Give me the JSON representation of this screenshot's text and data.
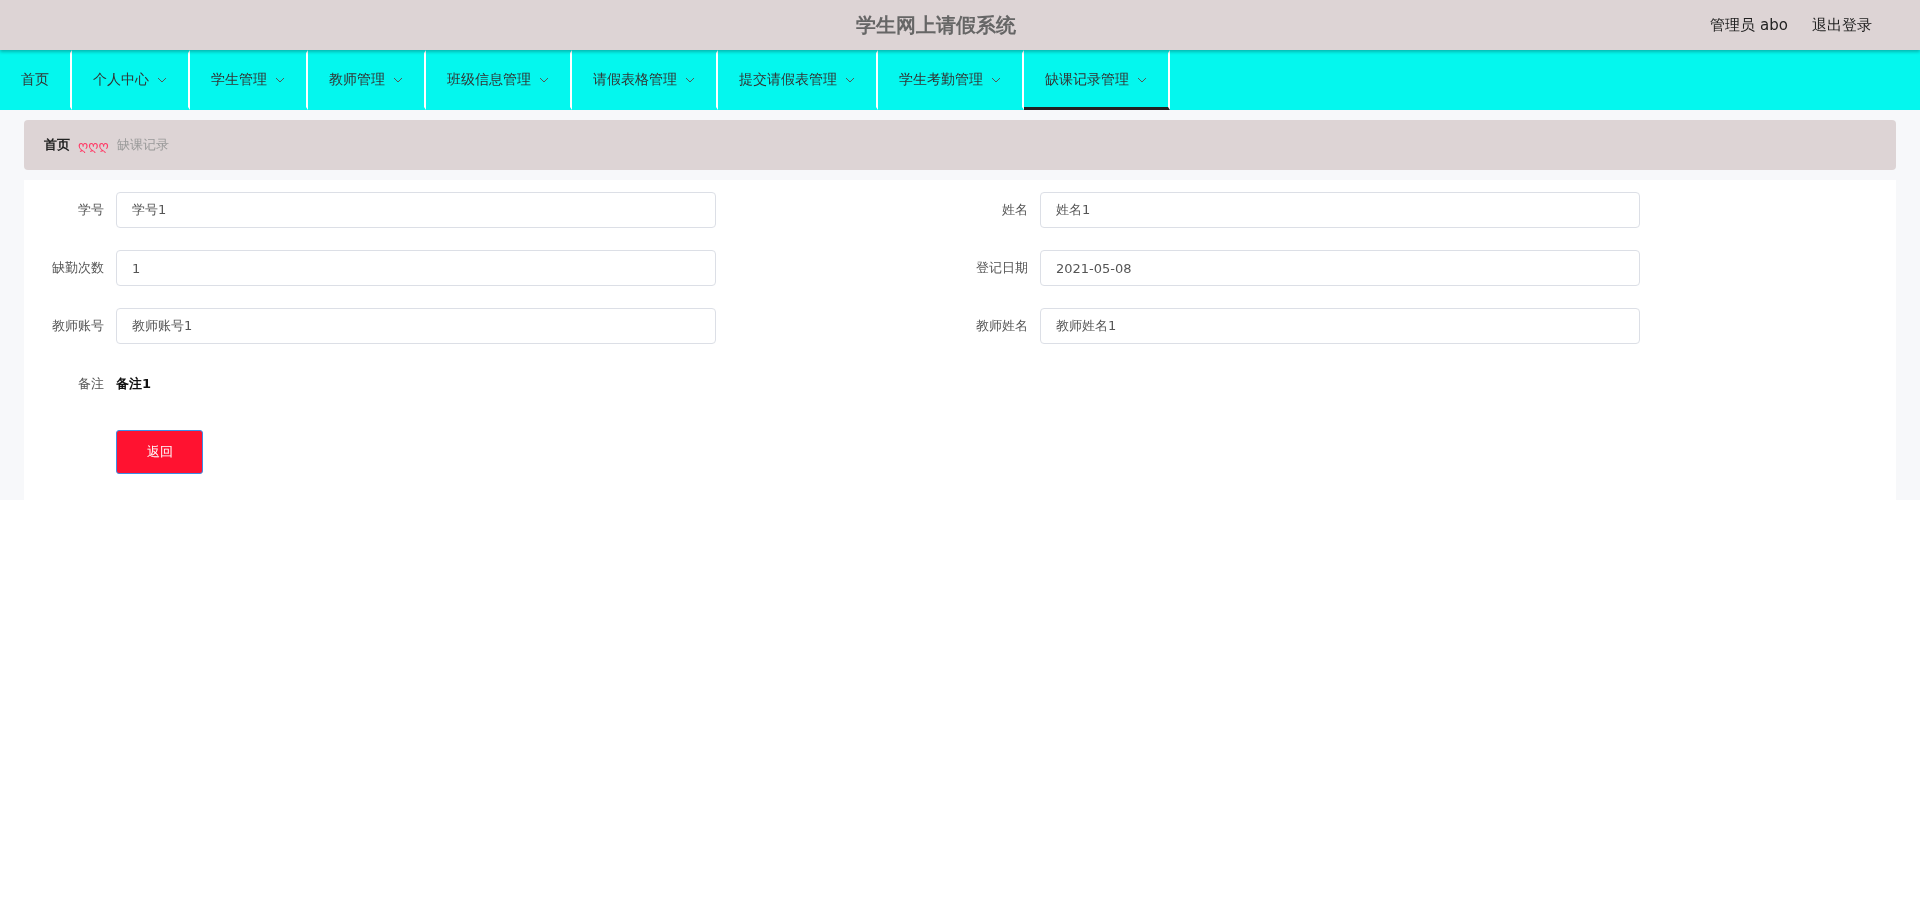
{
  "header": {
    "title": "学生网上请假系统",
    "user": "管理员 abo",
    "logout": "退出登录"
  },
  "nav": [
    {
      "label": "首页",
      "has_menu": false,
      "selected": false
    },
    {
      "label": "个人中心",
      "has_menu": true,
      "selected": false
    },
    {
      "label": "学生管理",
      "has_menu": true,
      "selected": false
    },
    {
      "label": "教师管理",
      "has_menu": true,
      "selected": false
    },
    {
      "label": "班级信息管理",
      "has_menu": true,
      "selected": false
    },
    {
      "label": "请假表格管理",
      "has_menu": true,
      "selected": false
    },
    {
      "label": "提交请假表管理",
      "has_menu": true,
      "selected": false
    },
    {
      "label": "学生考勤管理",
      "has_menu": true,
      "selected": false
    },
    {
      "label": "缺课记录管理",
      "has_menu": true,
      "selected": true
    }
  ],
  "breadcrumb": {
    "home": "首页",
    "separator": "ღღღ",
    "current": "缺课记录"
  },
  "form": {
    "fields": [
      {
        "label": "学号",
        "value": "学号1"
      },
      {
        "label": "姓名",
        "value": "姓名1"
      },
      {
        "label": "缺勤次数",
        "value": "1"
      },
      {
        "label": "登记日期",
        "value": "2021-05-08"
      },
      {
        "label": "教师账号",
        "value": "教师账号1"
      },
      {
        "label": "教师姓名",
        "value": "教师姓名1"
      }
    ],
    "note": {
      "label": "备注",
      "value": "备注1"
    },
    "back_button": "返回"
  }
}
